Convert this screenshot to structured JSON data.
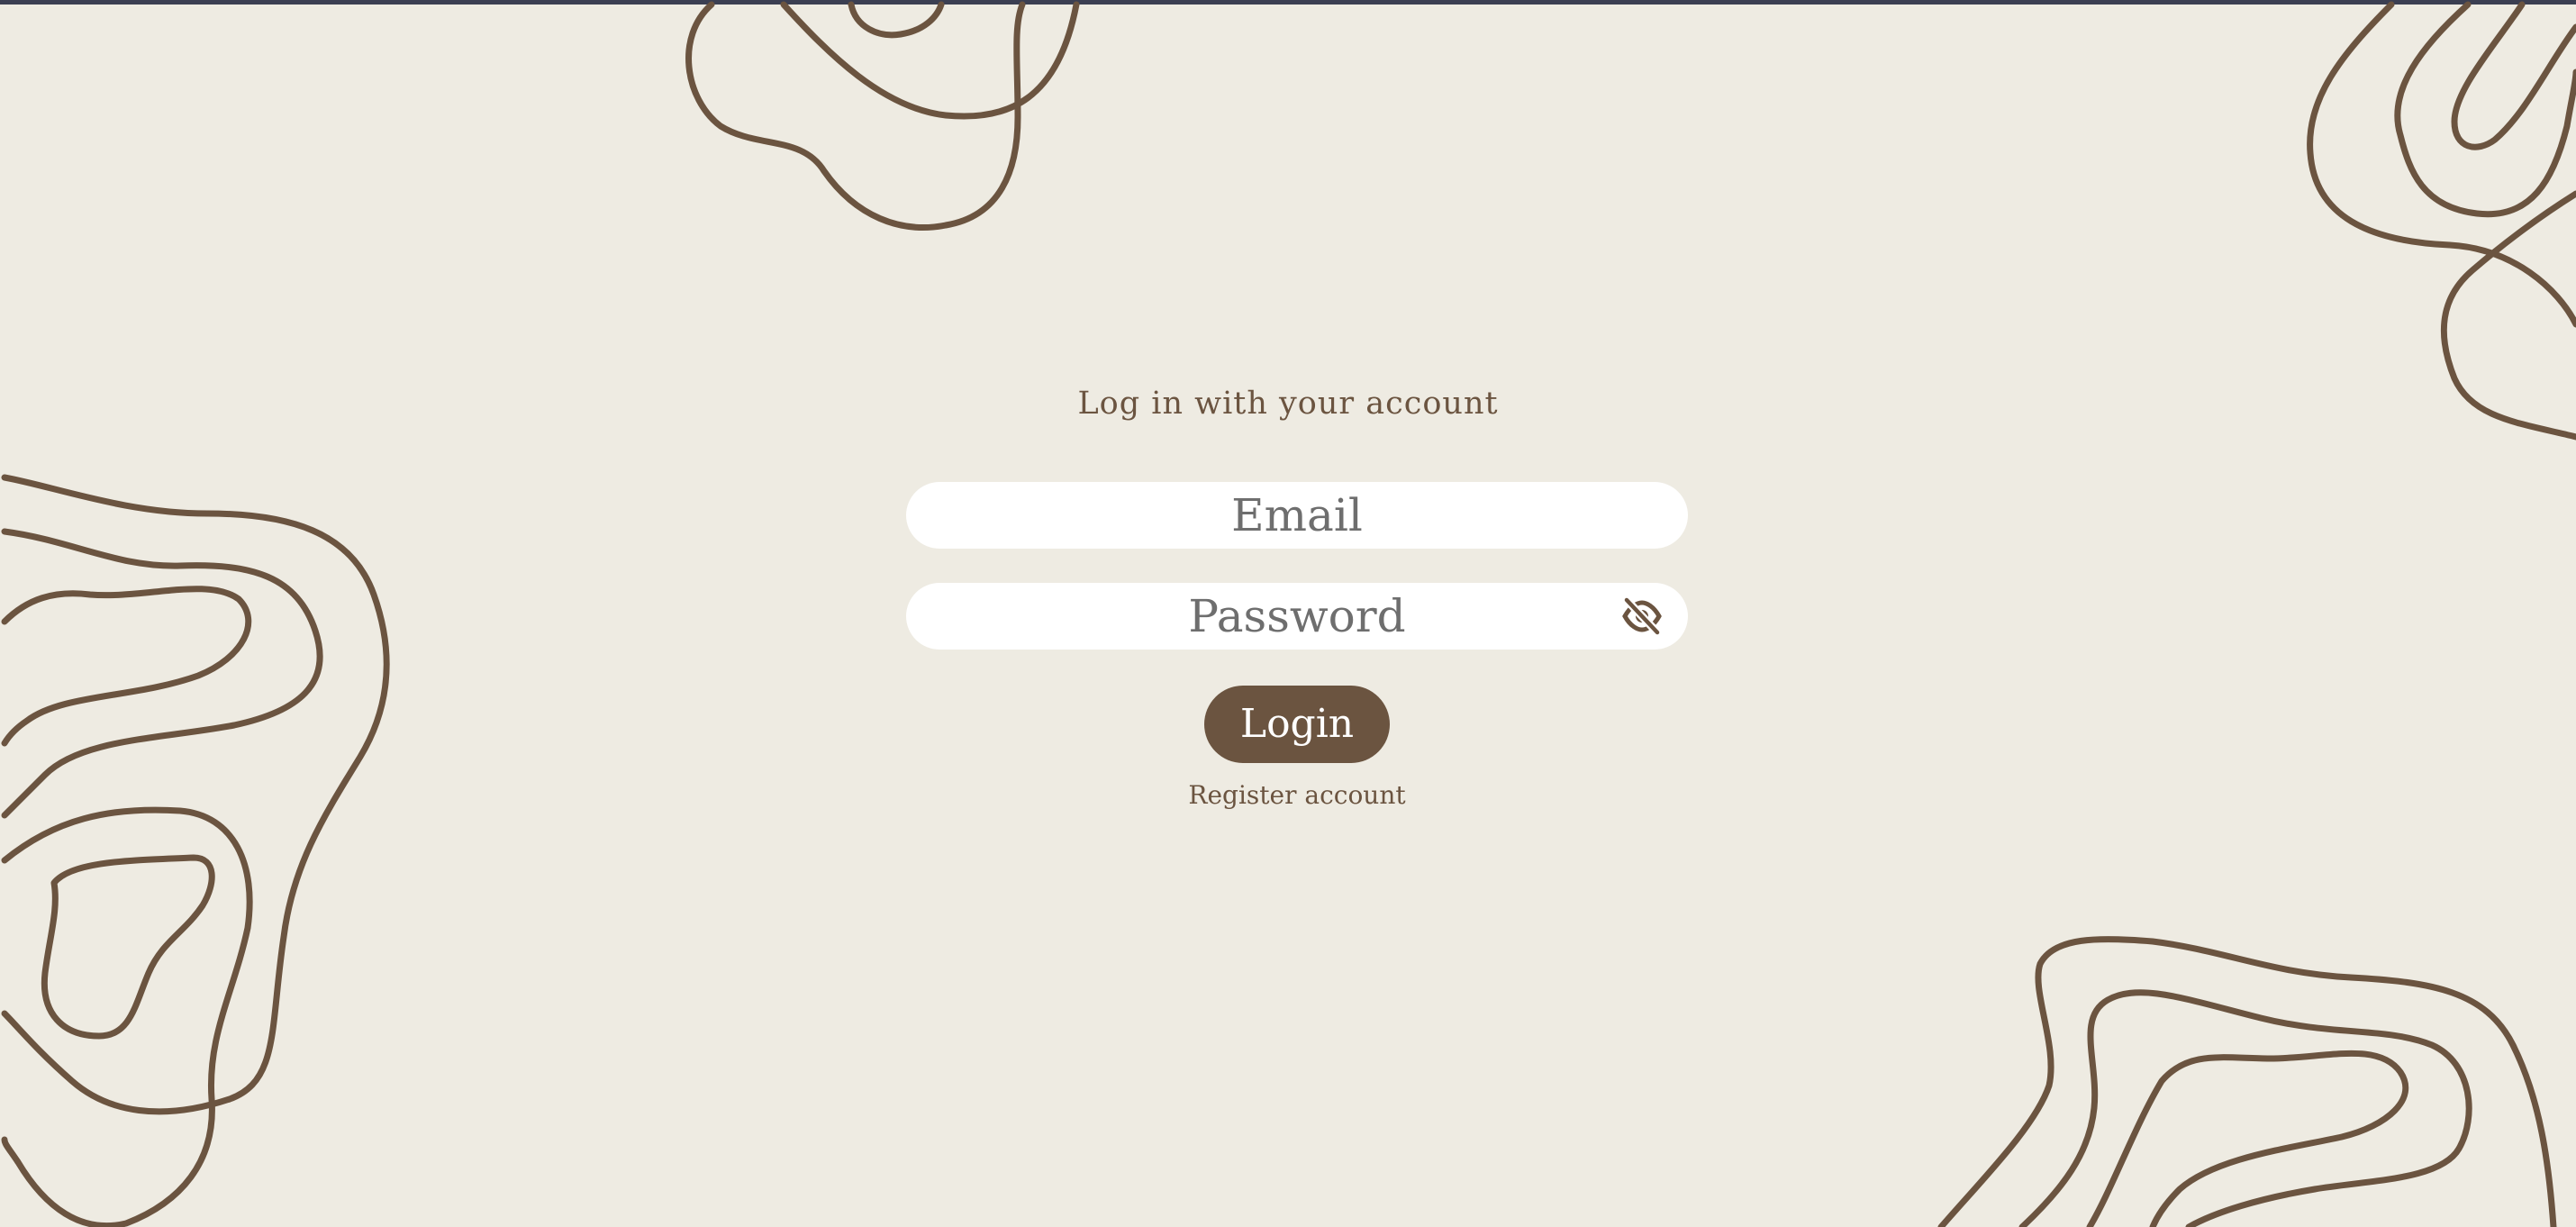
{
  "login": {
    "heading": "Log in with your account",
    "email_placeholder": "Email",
    "password_placeholder": "Password",
    "login_label": "Login",
    "register_label": "Register account"
  },
  "icons": {
    "password_toggle": "eye-slash-icon"
  },
  "colors": {
    "background": "#eeebe2",
    "accent": "#6b5440",
    "input_background": "#ffffff",
    "placeholder_text": "#6e6e6e",
    "top_strip": "#3b3f52"
  }
}
